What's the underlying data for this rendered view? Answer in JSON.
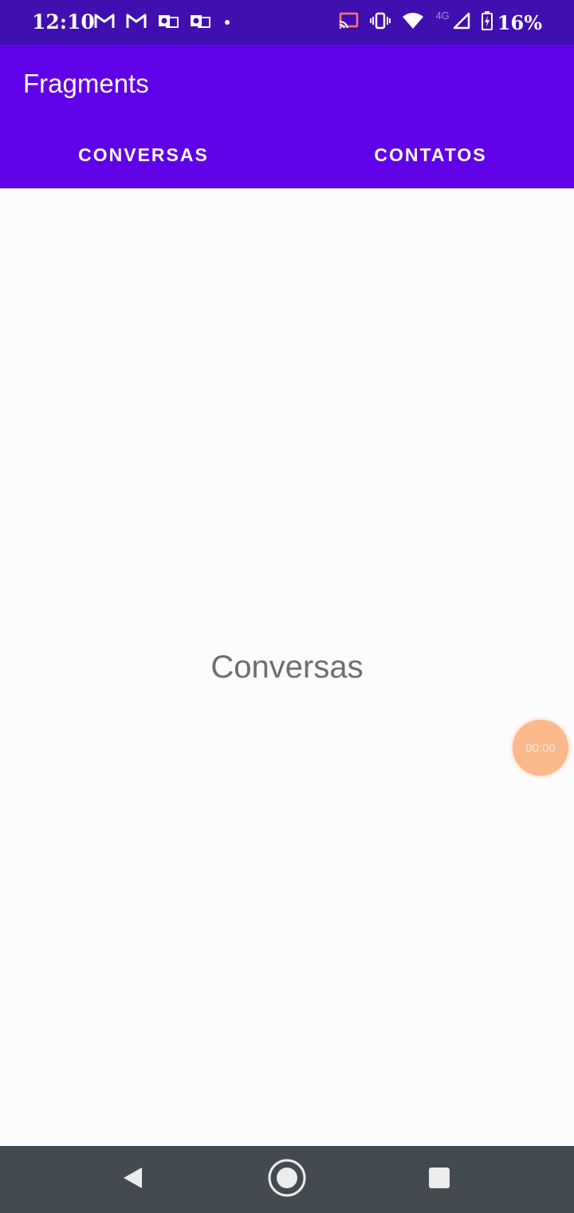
{
  "status_bar": {
    "time": "12:10",
    "battery_percent": "16%",
    "left_icons": [
      "gmail-icon",
      "gmail-icon",
      "outlook-icon",
      "outlook-icon",
      "dot-icon"
    ],
    "right_icons": [
      "cast-icon",
      "vibrate-icon",
      "wifi-icon",
      "4g-icon",
      "signal-icon",
      "battery-charging-icon"
    ],
    "network_label": "4G"
  },
  "app_bar": {
    "title": "Fragments",
    "color": "#6002e8"
  },
  "tabs": [
    {
      "label": "CONVERSAS",
      "selected": true
    },
    {
      "label": "CONTATOS",
      "selected": false
    }
  ],
  "content": {
    "text": "Conversas"
  },
  "timer_bubble": {
    "text": "00:00",
    "color": "#fbb98c"
  },
  "nav_bar": {
    "buttons": [
      "back-icon",
      "home-icon",
      "recents-icon"
    ]
  }
}
